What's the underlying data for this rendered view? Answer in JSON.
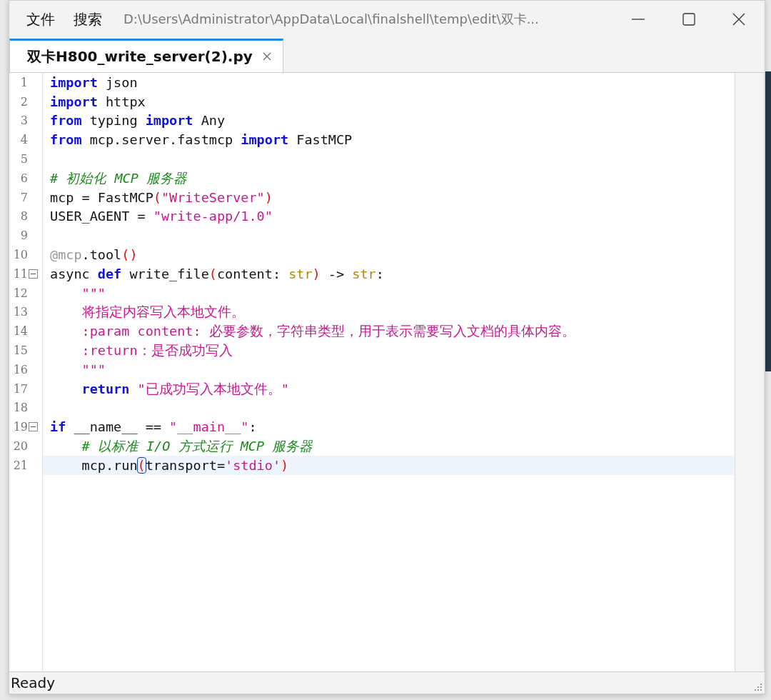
{
  "window": {
    "menu": [
      {
        "label": "文件"
      },
      {
        "label": "搜索"
      }
    ],
    "path": "D:\\Users\\Administrator\\AppData\\Local\\finalshell\\temp\\edit\\双卡..."
  },
  "tabs": [
    {
      "label": "双卡H800_write_server(2).py",
      "selected": true
    }
  ],
  "editor": {
    "lines": [
      {
        "number": "1",
        "fold": false,
        "current": false,
        "tokens": [
          {
            "kind": "keyword",
            "text": "import"
          },
          {
            "kind": "plain",
            "text": " json"
          }
        ]
      },
      {
        "number": "2",
        "fold": false,
        "current": false,
        "tokens": [
          {
            "kind": "keyword",
            "text": "import"
          },
          {
            "kind": "plain",
            "text": " httpx"
          }
        ]
      },
      {
        "number": "3",
        "fold": false,
        "current": false,
        "tokens": [
          {
            "kind": "keyword",
            "text": "from"
          },
          {
            "kind": "plain",
            "text": " typing "
          },
          {
            "kind": "keyword",
            "text": "import"
          },
          {
            "kind": "plain",
            "text": " Any"
          }
        ]
      },
      {
        "number": "4",
        "fold": false,
        "current": false,
        "tokens": [
          {
            "kind": "keyword",
            "text": "from"
          },
          {
            "kind": "plain",
            "text": " mcp.server.fastmcp "
          },
          {
            "kind": "keyword",
            "text": "import"
          },
          {
            "kind": "plain",
            "text": " FastMCP"
          }
        ]
      },
      {
        "number": "5",
        "fold": false,
        "current": false
      },
      {
        "number": "6",
        "fold": false,
        "current": false,
        "tokens": [
          {
            "kind": "comment",
            "text": "# 初始化 MCP 服务器"
          }
        ]
      },
      {
        "number": "7",
        "fold": false,
        "current": false,
        "tokens": [
          {
            "kind": "plain",
            "text": "mcp = FastMCP"
          },
          {
            "kind": "paren",
            "text": "("
          },
          {
            "kind": "string",
            "text": "\"WriteServer\""
          },
          {
            "kind": "paren",
            "text": ")"
          }
        ]
      },
      {
        "number": "8",
        "fold": false,
        "current": false,
        "tokens": [
          {
            "kind": "plain",
            "text": "USER_AGENT = "
          },
          {
            "kind": "string",
            "text": "\"write-app/1.0\""
          }
        ]
      },
      {
        "number": "9",
        "fold": false,
        "current": false
      },
      {
        "number": "10",
        "fold": false,
        "current": false,
        "tokens": [
          {
            "kind": "decorator",
            "text": "@mcp"
          },
          {
            "kind": "plain",
            "text": ".tool"
          },
          {
            "kind": "paren",
            "text": "()"
          }
        ]
      },
      {
        "number": "11",
        "fold": true,
        "current": false,
        "tokens": [
          {
            "kind": "plain",
            "text": "async "
          },
          {
            "kind": "keyword",
            "text": "def"
          },
          {
            "kind": "plain",
            "text": " write_file"
          },
          {
            "kind": "paren",
            "text": "("
          },
          {
            "kind": "plain",
            "text": "content: "
          },
          {
            "kind": "type",
            "text": "str"
          },
          {
            "kind": "paren",
            "text": ")"
          },
          {
            "kind": "plain",
            "text": " -> "
          },
          {
            "kind": "type",
            "text": "str"
          },
          {
            "kind": "plain",
            "text": ":"
          }
        ]
      },
      {
        "number": "12",
        "fold": false,
        "current": false,
        "tokens": [
          {
            "kind": "string",
            "text": "    \"\"\""
          }
        ]
      },
      {
        "number": "13",
        "fold": false,
        "current": false,
        "tokens": [
          {
            "kind": "string",
            "text": "    将指定内容写入本地文件。"
          }
        ]
      },
      {
        "number": "14",
        "fold": false,
        "current": false,
        "tokens": [
          {
            "kind": "string",
            "text": "    :param content: 必要参数，字符串类型，用于表示需要写入文档的具体内容。"
          }
        ]
      },
      {
        "number": "15",
        "fold": false,
        "current": false,
        "tokens": [
          {
            "kind": "string",
            "text": "    :return：是否成功写入"
          }
        ]
      },
      {
        "number": "16",
        "fold": false,
        "current": false,
        "tokens": [
          {
            "kind": "string",
            "text": "    \"\"\""
          }
        ]
      },
      {
        "number": "17",
        "fold": false,
        "current": false,
        "tokens": [
          {
            "kind": "keyword",
            "text": "    return"
          },
          {
            "kind": "string",
            "text": " \"已成功写入本地文件。\""
          }
        ]
      },
      {
        "number": "18",
        "fold": false,
        "current": false
      },
      {
        "number": "19",
        "fold": true,
        "current": false,
        "tokens": [
          {
            "kind": "keyword",
            "text": "if"
          },
          {
            "kind": "plain",
            "text": " __name__ == "
          },
          {
            "kind": "string",
            "text": "\"__main__\""
          },
          {
            "kind": "plain",
            "text": ":"
          }
        ]
      },
      {
        "number": "20",
        "fold": false,
        "current": false,
        "tokens": [
          {
            "kind": "comment",
            "text": "    # 以标准 I/O 方式运行 MCP 服务器"
          }
        ]
      },
      {
        "number": "21",
        "fold": false,
        "current": true,
        "tokens": [
          {
            "kind": "plain",
            "text": "    mcp.run"
          },
          {
            "kind": "match",
            "text": "("
          },
          {
            "kind": "plain",
            "text": "transport="
          },
          {
            "kind": "string",
            "text": "'stdio'"
          },
          {
            "kind": "paren",
            "text": ")"
          }
        ]
      }
    ]
  },
  "status_bar": {
    "text": "Ready"
  }
}
